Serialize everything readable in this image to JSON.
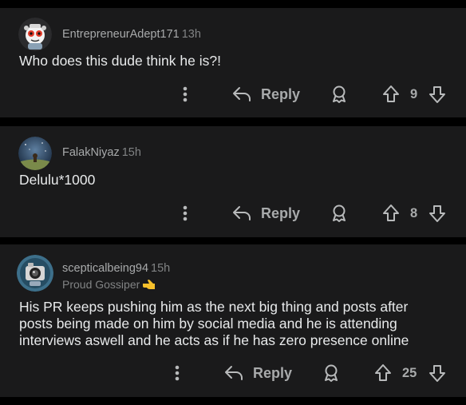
{
  "comments": [
    {
      "username": "EntrepreneurAdept171",
      "time": "13h",
      "flair": "",
      "body": "Who does this dude think he is?!",
      "reply_label": "Reply",
      "score": "9",
      "avatar": "robot-snoo-avatar"
    },
    {
      "username": "FalakNiyaz",
      "time": "15h",
      "flair": "",
      "body": "Delulu*1000",
      "reply_label": "Reply",
      "score": "8",
      "avatar": "night-sky-avatar"
    },
    {
      "username": "scepticalbeing94",
      "time": "15h",
      "flair": "Proud Gossiper",
      "flair_emoji": "point-left-hand-emoji",
      "body": "His PR keeps pushing him as the next big thing and posts after posts being made on him by social media and he is attending interviews aswell and he acts as if he has zero presence online",
      "reply_label": "Reply",
      "score": "25",
      "avatar": "camera-snoo-avatar"
    }
  ],
  "colors": {
    "background": "#000000",
    "card": "#1a1a1b",
    "text": "#e8eaeb",
    "muted": "#a8aaab"
  }
}
